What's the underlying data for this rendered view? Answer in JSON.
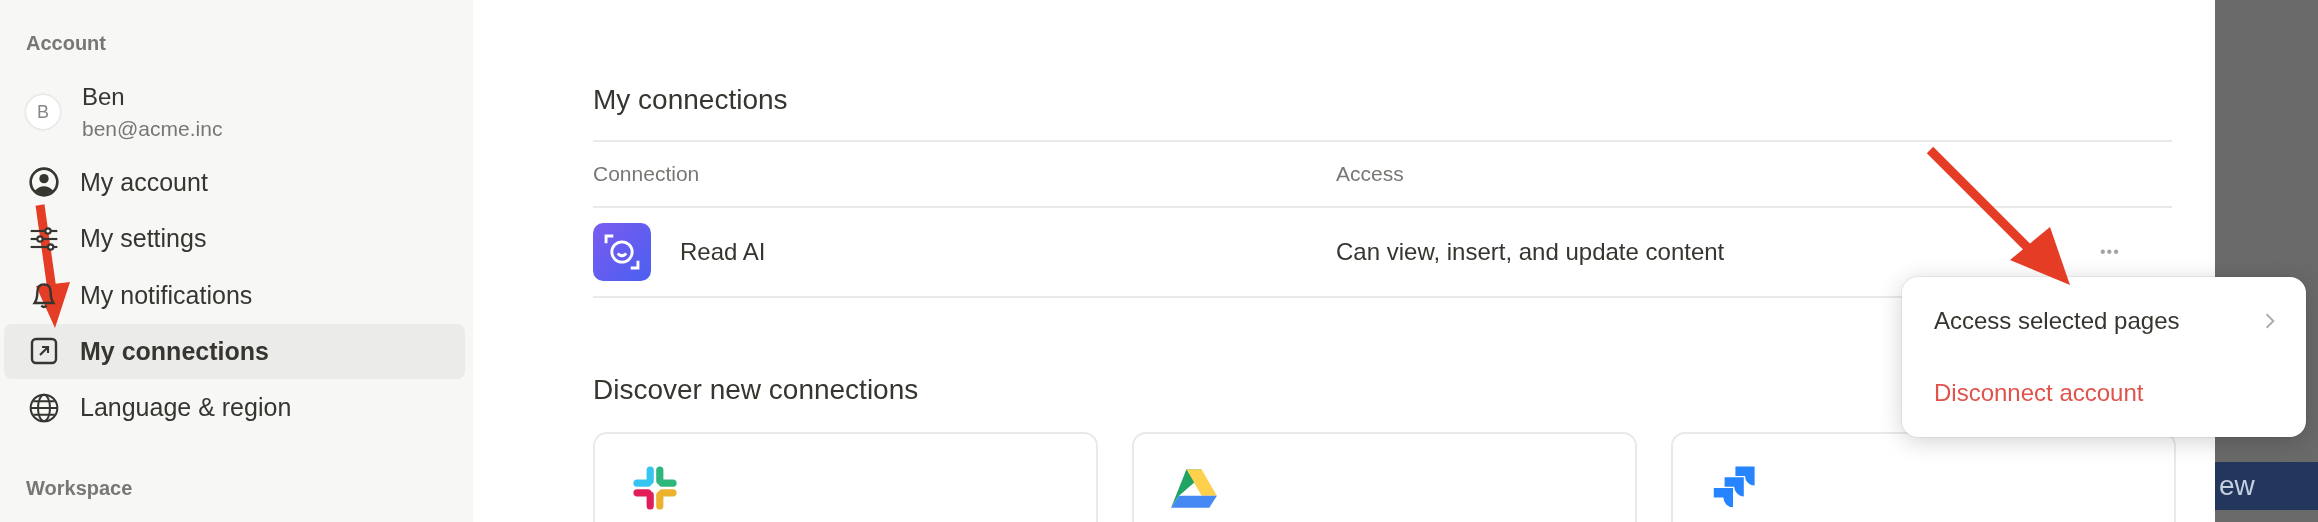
{
  "sidebar": {
    "section_title": "Account",
    "user": {
      "initial": "B",
      "name": "Ben",
      "email": "ben@acme.inc"
    },
    "items": [
      {
        "label": "My account",
        "selected": false
      },
      {
        "label": "My settings",
        "selected": false
      },
      {
        "label": "My notifications",
        "selected": false
      },
      {
        "label": "My connections",
        "selected": true
      },
      {
        "label": "Language & region",
        "selected": false
      }
    ],
    "section_title_2": "Workspace"
  },
  "main": {
    "title": "My connections",
    "table": {
      "columns": [
        "Connection",
        "Access"
      ],
      "rows": [
        {
          "name": "Read AI",
          "access": "Can view, insert, and update content",
          "more": "•••"
        }
      ]
    },
    "discover_title": "Discover new connections",
    "cards": [
      {
        "kind": "slack"
      },
      {
        "kind": "drive"
      },
      {
        "kind": "jira"
      }
    ]
  },
  "menu": {
    "items": [
      {
        "label": "Access selected pages",
        "kind": "submenu"
      },
      {
        "label": "Disconnect account",
        "kind": "danger"
      }
    ]
  },
  "background_text": "ew"
}
